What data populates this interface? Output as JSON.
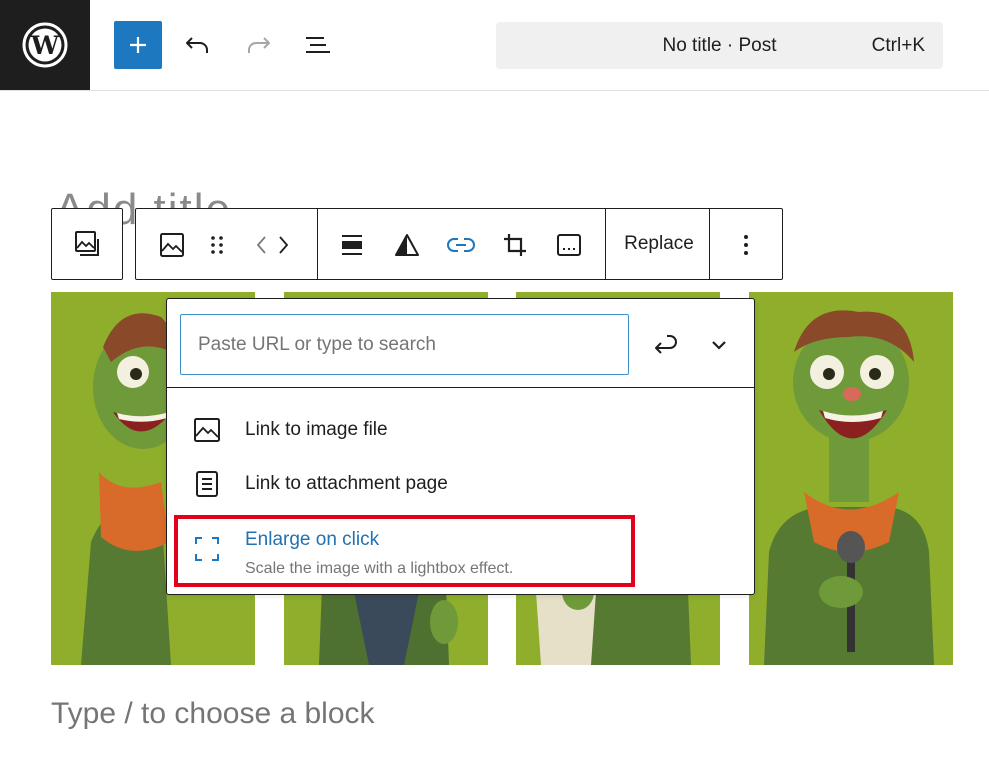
{
  "header": {
    "logo_icon": "wordpress-logo-icon",
    "add_block_icon": "plus-icon",
    "undo_icon": "undo-icon",
    "redo_icon": "redo-icon",
    "document_overview_icon": "list-view-icon",
    "command_bar": {
      "title": "No title · Post",
      "shortcut": "Ctrl+K"
    }
  },
  "editor": {
    "title_placeholder": "Add title",
    "appender_placeholder": "Type / to choose a block"
  },
  "block_toolbar": {
    "parent_icon": "gallery-icon",
    "block_icon": "image-icon",
    "drag_icon": "drag-handle-icon",
    "move_icons": [
      "chevron-left-icon",
      "chevron-right-icon"
    ],
    "align_icon": "align-wide-icon",
    "duotone_icon": "duotone-icon",
    "link_icon": "link-icon",
    "crop_icon": "crop-icon",
    "caption_icon": "caption-icon",
    "replace_label": "Replace",
    "options_icon": "more-vertical-icon"
  },
  "link_popover": {
    "search_placeholder": "Paste URL or type to search",
    "search_value": "",
    "submit_icon": "enter-icon",
    "expand_icon": "chevron-down-icon",
    "items": [
      {
        "label": "Link to image file",
        "icon": "image-icon"
      },
      {
        "label": "Link to attachment page",
        "icon": "page-icon"
      }
    ],
    "enlarge": {
      "label": "Enlarge on click",
      "description": "Scale the image with a lightbox effect.",
      "icon": "fullscreen-icon"
    }
  },
  "colors": {
    "accent": "#1e78c0",
    "link": "#2271b1",
    "highlight": "#e2001a",
    "image_background": "#8eae2c",
    "logo_background": "#1e1e1e"
  }
}
